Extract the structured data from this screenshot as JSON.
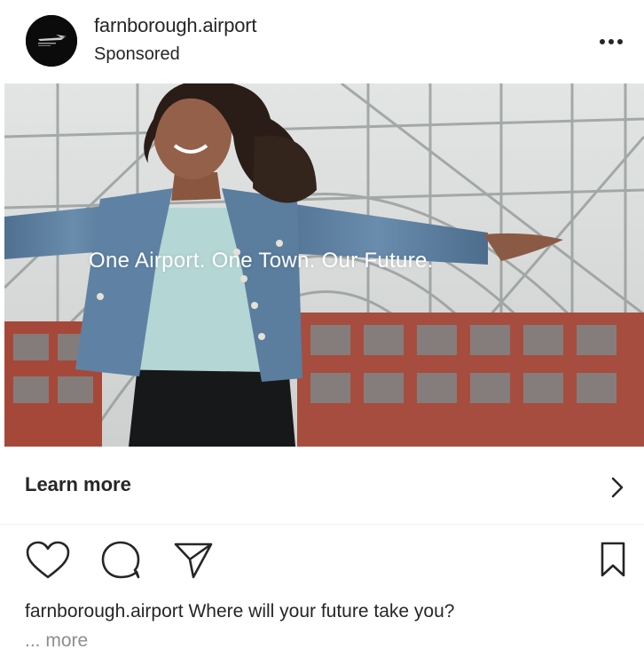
{
  "post": {
    "username": "farnborough.airport",
    "sponsored_label": "Sponsored",
    "avatar_icon": "farnborough-airport-logo",
    "options_icon": "more-horizontal-icon",
    "image": {
      "description_icon": "girl-arms-outstretched-hangar-photo",
      "tagline": "One Airport. One Town. Our Future."
    },
    "cta": {
      "label": "Learn more",
      "icon": "chevron-right-icon"
    },
    "actions": {
      "like_icon": "heart-icon",
      "comment_icon": "comment-icon",
      "share_icon": "send-icon",
      "save_icon": "bookmark-icon"
    },
    "caption": {
      "username": "farnborough.airport",
      "text": "Where will your future take you?",
      "ellipsis": "...",
      "more_label": "more"
    }
  },
  "colors": {
    "text": "#262626",
    "muted": "#8e8e8e",
    "brick": "#a5483a",
    "denim": "#5d7fa0"
  }
}
